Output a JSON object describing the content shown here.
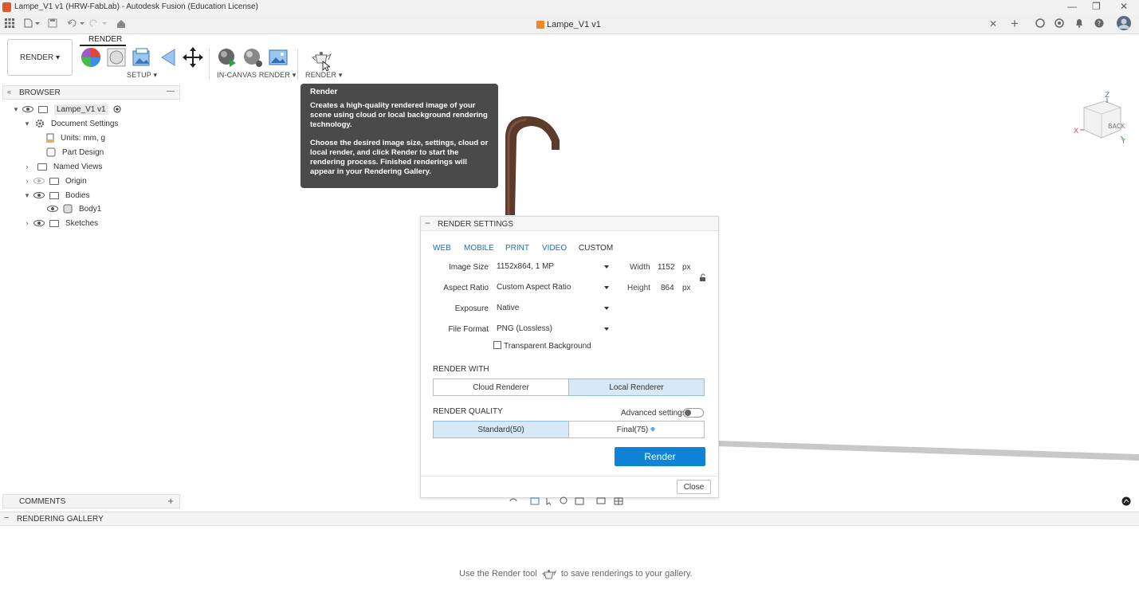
{
  "window": {
    "title": "Lampe_V1 v1 (HRW-FabLab) - Autodesk Fusion (Education License)",
    "controls": [
      "—",
      "❐",
      "✕"
    ]
  },
  "tabbar": {
    "document_tab": "Lampe_V1 v1",
    "close_glyph": "✕",
    "new_tab_glyph": "+"
  },
  "toolbar": {
    "workspace": "RENDER ▾",
    "active_tab": "RENDER",
    "groups": {
      "setup": "SETUP ▾",
      "in_canvas": "IN-CANVAS RENDER ▾",
      "render": "RENDER ▾"
    }
  },
  "browser": {
    "header": "BROWSER",
    "collapse_glyph": "—",
    "items": [
      {
        "label": "Lampe_V1 v1"
      },
      {
        "label": "Document Settings"
      },
      {
        "label": "Units: mm, g"
      },
      {
        "label": "Part Design"
      },
      {
        "label": "Named Views"
      },
      {
        "label": "Origin"
      },
      {
        "label": "Bodies"
      },
      {
        "label": "Body1"
      },
      {
        "label": "Sketches"
      }
    ]
  },
  "tooltip": {
    "title": "Render",
    "paragraph1": "Creates a high-quality rendered image of your scene using cloud or local background rendering technology.",
    "paragraph2": "Choose the desired image size, settings, cloud or local render, and click Render to start the rendering process. Finished renderings will appear in your Rendering Gallery."
  },
  "render_settings": {
    "header": "RENDER SETTINGS",
    "collapse_glyph": "−",
    "presets": [
      "WEB",
      "MOBILE",
      "PRINT",
      "VIDEO",
      "CUSTOM"
    ],
    "active_preset": "CUSTOM",
    "image_size_label": "Image Size",
    "image_size_value": "1152x864, 1 MP",
    "aspect_ratio_label": "Aspect Ratio",
    "aspect_ratio_value": "Custom Aspect Ratio",
    "exposure_label": "Exposure",
    "exposure_value": "Native",
    "file_format_label": "File Format",
    "file_format_value": "PNG (Lossless)",
    "transparent_bg_label": "Transparent Background",
    "width_label": "Width",
    "width_value": "1152",
    "height_label": "Height",
    "height_value": "864",
    "unit": "px",
    "render_with_label": "RENDER WITH",
    "cloud_renderer": "Cloud Renderer",
    "local_renderer": "Local Renderer",
    "render_quality_label": "RENDER QUALITY",
    "advanced_settings_label": "Advanced settings",
    "standard_quality": "Standard(50)",
    "final_quality": "Final(75)",
    "render_button": "Render",
    "close_button": "Close"
  },
  "comments": {
    "header": "COMMENTS",
    "add_glyph": "+"
  },
  "gallery": {
    "header": "RENDERING GALLERY",
    "collapse_glyph": "−",
    "message_before": "Use the Render tool",
    "message_after": "to save renderings to your gallery."
  },
  "viewcube": {
    "face": "BACK",
    "axis_z": "Z",
    "axis_x": "X",
    "axis_y": "Y"
  },
  "colors": {
    "accent": "#0f83d6",
    "selected_segment": "#d7e9f7",
    "tooltip_bg": "#4a4a4a",
    "lamp": "#5b3b2c"
  }
}
